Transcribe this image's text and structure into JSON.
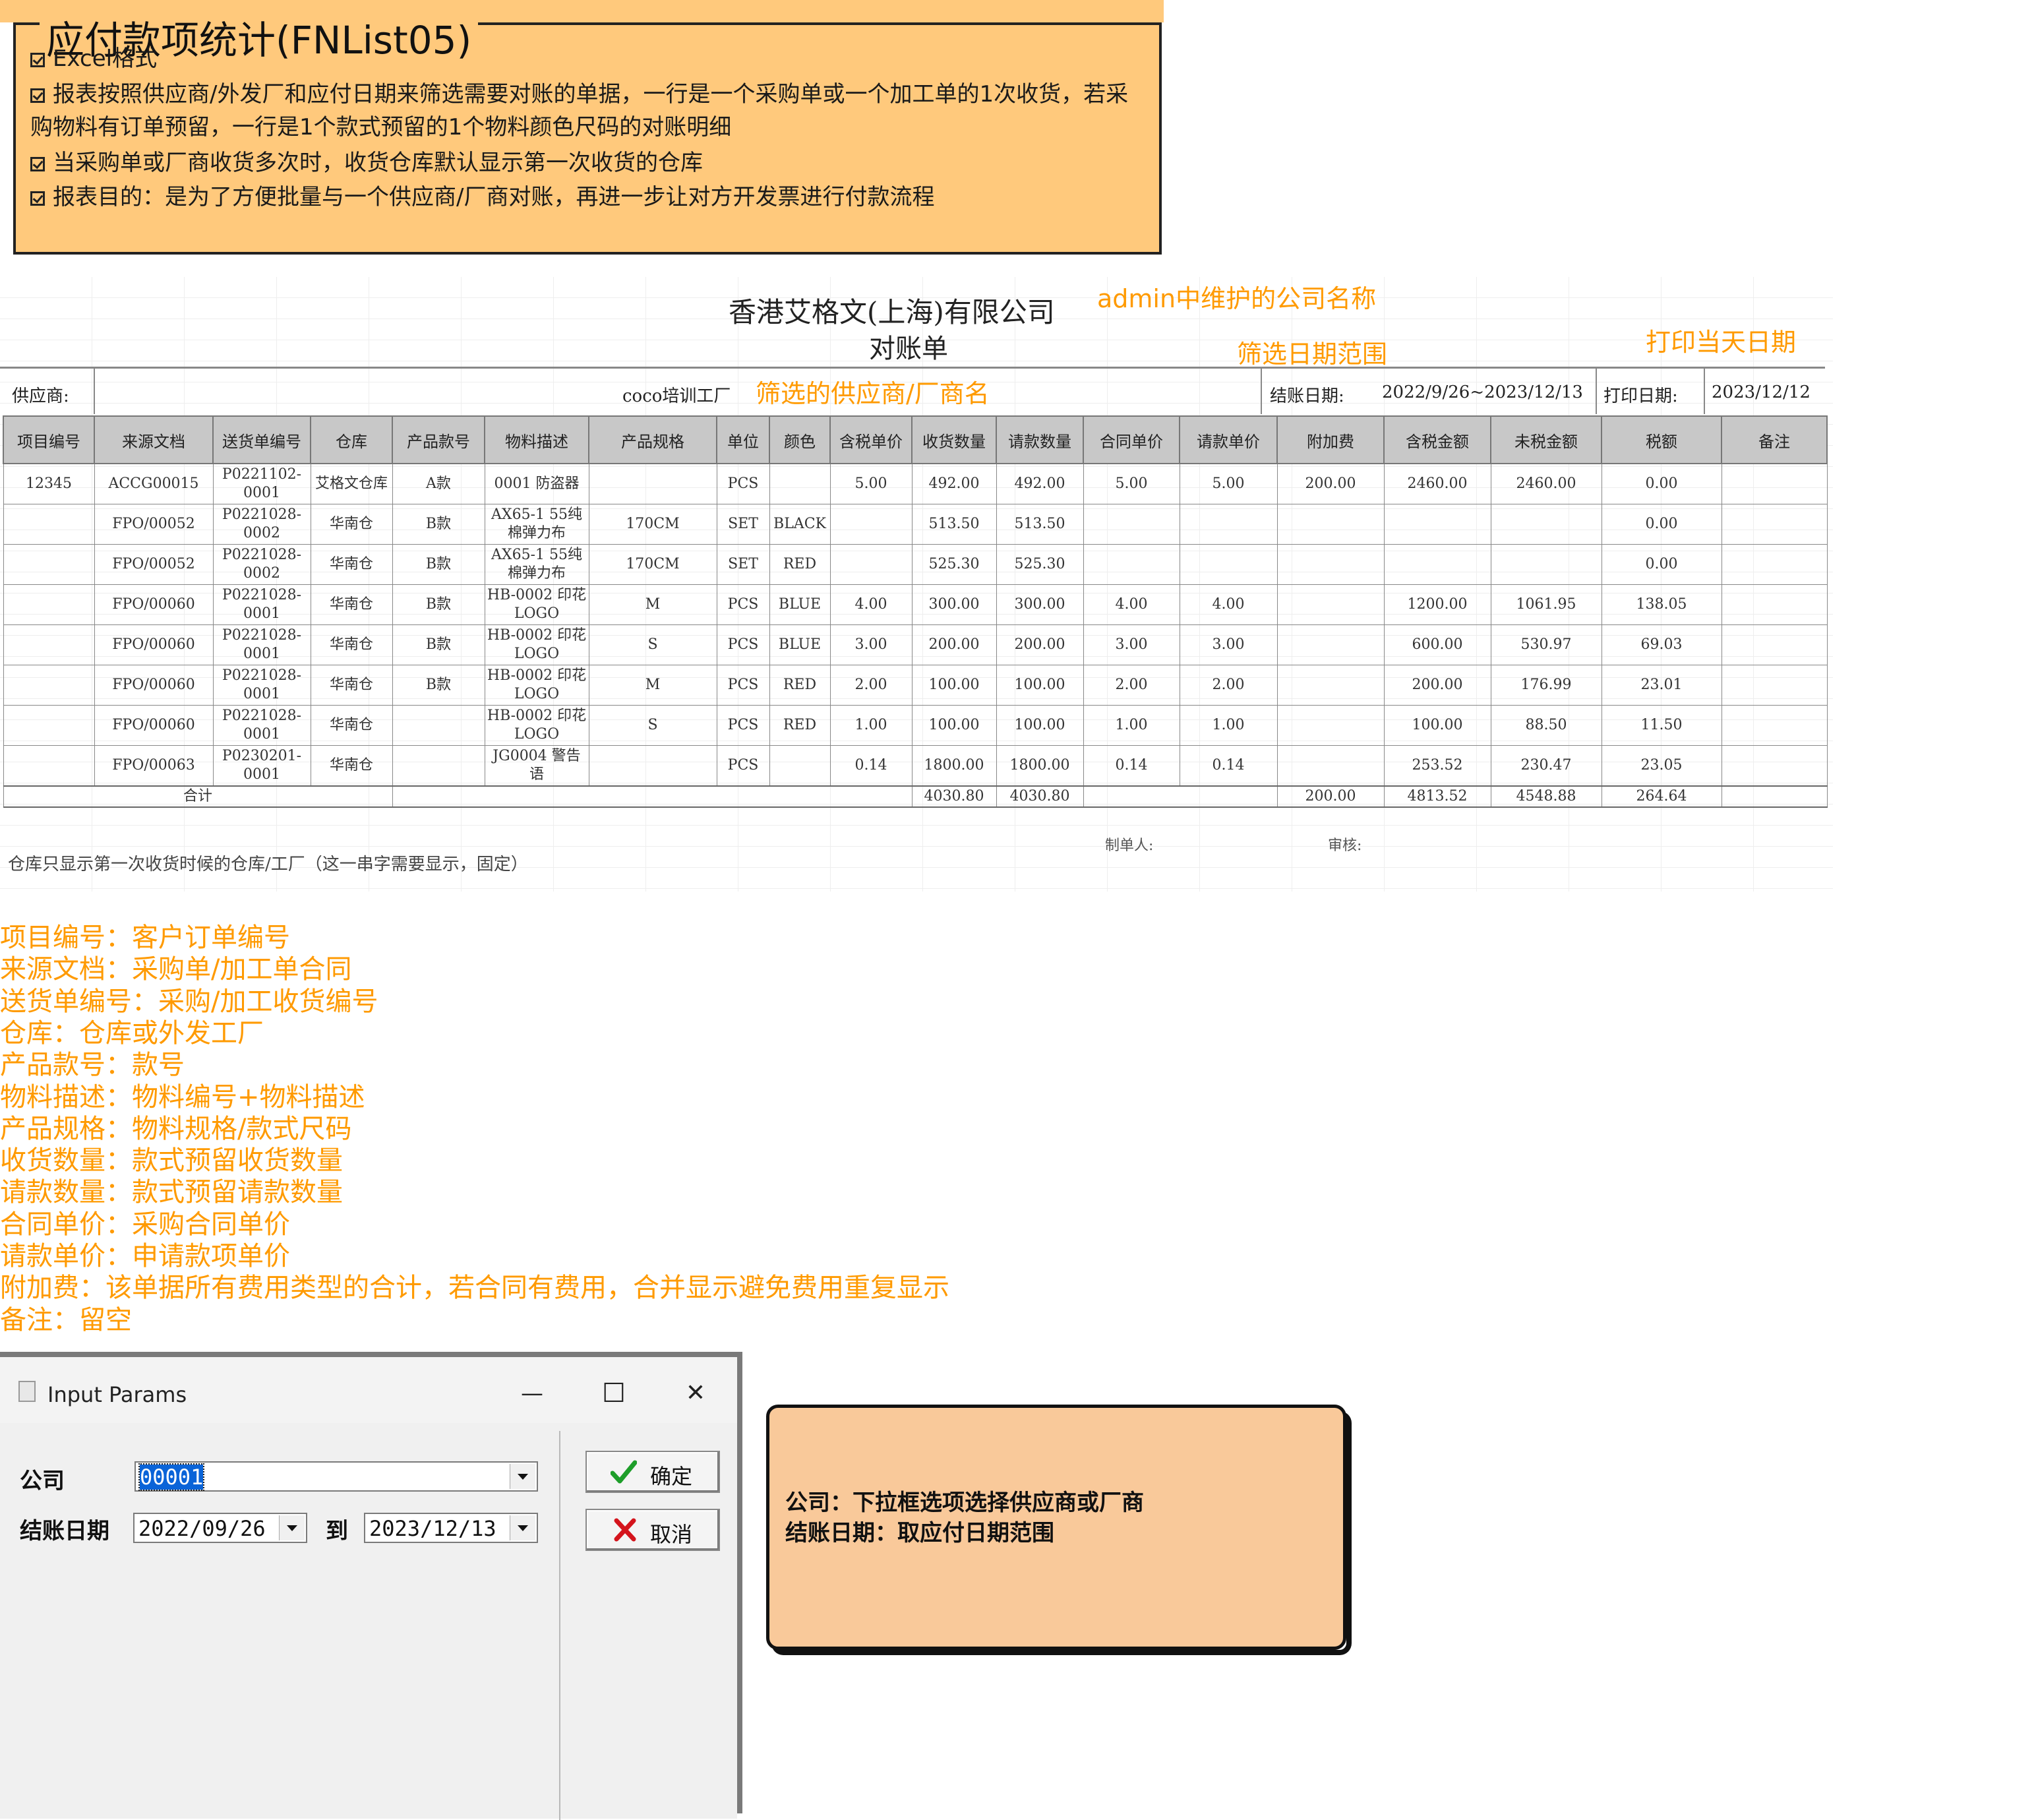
{
  "spec": {
    "title": "应付款项统计(FNList05)",
    "items": [
      "Excel格式",
      "报表按照供应商/外发厂和应付日期来筛选需要对账的单据，一行是一个采购单或一个加工单的1次收货，若采",
      "购物料有订单预留，一行是1个款式预留的1个物料颜色尺码的对账明细",
      "当采购单或厂商收货多次时，收货仓库默认显示第一次收货的仓库",
      "报表目的：是为了方便批量与一个供应商/厂商对账，再进一步让对方开发票进行付款流程"
    ]
  },
  "sheet": {
    "company_name": "香港艾格文(上海)有限公司",
    "doc_title": "对账单",
    "supplier_label": "供应商:",
    "supplier_value": "coco培训工厂",
    "settle_label": "结账日期:",
    "settle_value": "2022/9/26~2023/12/13",
    "print_label": "打印日期:",
    "print_value": "2023/12/12",
    "columns": [
      "项目编号",
      "来源文档",
      "送货单编号",
      "仓库",
      "产品款号",
      "物料描述",
      "产品规格",
      "单位",
      "颜色",
      "含税单价",
      "收货数量",
      "请款数量",
      "合同单价",
      "请款单价",
      "附加费",
      "含税金额",
      "未税金额",
      "税额",
      "备注"
    ],
    "rows": [
      [
        "12345",
        "ACCG00015",
        "P0221102-\n0001",
        "艾格文仓库",
        "A款",
        "0001 防盗器",
        "",
        "PCS",
        "",
        "5.00",
        "492.00",
        "492.00",
        "5.00",
        "5.00",
        "200.00",
        "2460.00",
        "2460.00",
        "0.00",
        ""
      ],
      [
        "",
        "FPO/00052",
        "P0221028-\n0002",
        "华南仓",
        "B款",
        "AX65-1 55纯\n棉弹力布",
        "170CM",
        "SET",
        "BLACK",
        "",
        "513.50",
        "513.50",
        "",
        "",
        "",
        "",
        "",
        "0.00",
        ""
      ],
      [
        "",
        "FPO/00052",
        "P0221028-\n0002",
        "华南仓",
        "B款",
        "AX65-1 55纯\n棉弹力布",
        "170CM",
        "SET",
        "RED",
        "",
        "525.30",
        "525.30",
        "",
        "",
        "",
        "",
        "",
        "0.00",
        ""
      ],
      [
        "",
        "FPO/00060",
        "P0221028-\n0001",
        "华南仓",
        "B款",
        "HB-0002 印花\nLOGO",
        "M",
        "PCS",
        "BLUE",
        "4.00",
        "300.00",
        "300.00",
        "4.00",
        "4.00",
        "",
        "1200.00",
        "1061.95",
        "138.05",
        ""
      ],
      [
        "",
        "FPO/00060",
        "P0221028-\n0001",
        "华南仓",
        "B款",
        "HB-0002 印花\nLOGO",
        "S",
        "PCS",
        "BLUE",
        "3.00",
        "200.00",
        "200.00",
        "3.00",
        "3.00",
        "",
        "600.00",
        "530.97",
        "69.03",
        ""
      ],
      [
        "",
        "FPO/00060",
        "P0221028-\n0001",
        "华南仓",
        "B款",
        "HB-0002 印花\nLOGO",
        "M",
        "PCS",
        "RED",
        "2.00",
        "100.00",
        "100.00",
        "2.00",
        "2.00",
        "",
        "200.00",
        "176.99",
        "23.01",
        ""
      ],
      [
        "",
        "FPO/00060",
        "P0221028-\n0001",
        "华南仓",
        "",
        "HB-0002 印花\nLOGO",
        "S",
        "PCS",
        "RED",
        "1.00",
        "100.00",
        "100.00",
        "1.00",
        "1.00",
        "",
        "100.00",
        "88.50",
        "11.50",
        ""
      ],
      [
        "",
        "FPO/00063",
        "P0230201-\n0001",
        "华南仓",
        "",
        "JG0004 警告\n语",
        "",
        "PCS",
        "",
        "0.14",
        "1800.00",
        "1800.00",
        "0.14",
        "0.14",
        "",
        "253.52",
        "230.47",
        "23.05",
        ""
      ]
    ],
    "total": {
      "label": "合计",
      "recv_qty": "4030.80",
      "req_qty": "4030.80",
      "extra_fee": "200.00",
      "tax_incl": "4813.52",
      "tax_excl": "4548.88",
      "tax": "264.64"
    },
    "maker_label": "制单人:",
    "reviewer_label": "审核:",
    "footnote": "仓库只显示第一次收货时候的仓库/工厂（这一串字需要显示，固定）"
  },
  "annotations": {
    "company": "admin中维护的公司名称",
    "date_range": "筛选日期范围",
    "print_date": "打印当天日期",
    "supplier": "筛选的供应商/厂商名"
  },
  "definitions": [
    "项目编号：客户订单编号",
    "来源文档：采购单/加工单合同",
    "送货单编号：采购/加工收货编号",
    "仓库：仓库或外发工厂",
    "产品款号：款号",
    "物料描述：物料编号+物料描述",
    "产品规格：物料规格/款式尺码",
    "收货数量：款式预留收货数量",
    "请款数量：款式预留请款数量",
    "合同单价：采购合同单价",
    "请款单价：申请款项单价",
    "附加费：该单据所有费用类型的合计，若合同有费用，合并显示避免费用重复显示",
    "备注：留空"
  ],
  "dialog": {
    "title": "Input Params",
    "company_label": "公司",
    "company_value": "00001",
    "date_label": "结账日期",
    "date_from": "2022/09/26",
    "to_label": "到",
    "date_to": "2023/12/13",
    "ok_label": "确定",
    "cancel_label": "取消",
    "min_glyph": "—",
    "max_glyph": "☐",
    "close_glyph": "✕"
  },
  "note": {
    "line1": "公司：下拉框选项选择供应商或厂商",
    "line2": "结账日期：取应付日期范围"
  },
  "colors": {
    "spec_bg": "#ffc97c",
    "annotation": "#ff9a00",
    "note_bg": "#f9c99a",
    "header_gray": "#c8c8c8",
    "selection_blue": "#0a64d8"
  }
}
